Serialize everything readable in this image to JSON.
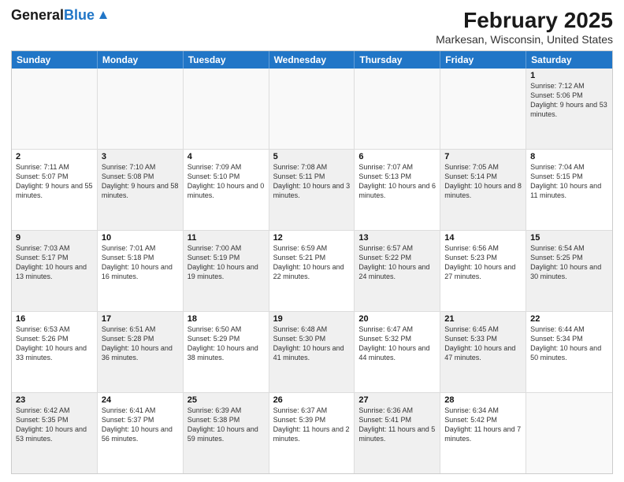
{
  "header": {
    "logo_general": "General",
    "logo_blue": "Blue",
    "title": "February 2025",
    "location": "Markesan, Wisconsin, United States"
  },
  "weekdays": [
    "Sunday",
    "Monday",
    "Tuesday",
    "Wednesday",
    "Thursday",
    "Friday",
    "Saturday"
  ],
  "weeks": [
    [
      {
        "day": "",
        "info": "",
        "empty": true
      },
      {
        "day": "",
        "info": "",
        "empty": true
      },
      {
        "day": "",
        "info": "",
        "empty": true
      },
      {
        "day": "",
        "info": "",
        "empty": true
      },
      {
        "day": "",
        "info": "",
        "empty": true
      },
      {
        "day": "",
        "info": "",
        "empty": true
      },
      {
        "day": "1",
        "info": "Sunrise: 7:12 AM\nSunset: 5:06 PM\nDaylight: 9 hours and 53 minutes.",
        "shaded": true
      }
    ],
    [
      {
        "day": "2",
        "info": "Sunrise: 7:11 AM\nSunset: 5:07 PM\nDaylight: 9 hours and 55 minutes."
      },
      {
        "day": "3",
        "info": "Sunrise: 7:10 AM\nSunset: 5:08 PM\nDaylight: 9 hours and 58 minutes.",
        "shaded": true
      },
      {
        "day": "4",
        "info": "Sunrise: 7:09 AM\nSunset: 5:10 PM\nDaylight: 10 hours and 0 minutes."
      },
      {
        "day": "5",
        "info": "Sunrise: 7:08 AM\nSunset: 5:11 PM\nDaylight: 10 hours and 3 minutes.",
        "shaded": true
      },
      {
        "day": "6",
        "info": "Sunrise: 7:07 AM\nSunset: 5:13 PM\nDaylight: 10 hours and 6 minutes."
      },
      {
        "day": "7",
        "info": "Sunrise: 7:05 AM\nSunset: 5:14 PM\nDaylight: 10 hours and 8 minutes.",
        "shaded": true
      },
      {
        "day": "8",
        "info": "Sunrise: 7:04 AM\nSunset: 5:15 PM\nDaylight: 10 hours and 11 minutes."
      }
    ],
    [
      {
        "day": "9",
        "info": "Sunrise: 7:03 AM\nSunset: 5:17 PM\nDaylight: 10 hours and 13 minutes.",
        "shaded": true
      },
      {
        "day": "10",
        "info": "Sunrise: 7:01 AM\nSunset: 5:18 PM\nDaylight: 10 hours and 16 minutes."
      },
      {
        "day": "11",
        "info": "Sunrise: 7:00 AM\nSunset: 5:19 PM\nDaylight: 10 hours and 19 minutes.",
        "shaded": true
      },
      {
        "day": "12",
        "info": "Sunrise: 6:59 AM\nSunset: 5:21 PM\nDaylight: 10 hours and 22 minutes."
      },
      {
        "day": "13",
        "info": "Sunrise: 6:57 AM\nSunset: 5:22 PM\nDaylight: 10 hours and 24 minutes.",
        "shaded": true
      },
      {
        "day": "14",
        "info": "Sunrise: 6:56 AM\nSunset: 5:23 PM\nDaylight: 10 hours and 27 minutes."
      },
      {
        "day": "15",
        "info": "Sunrise: 6:54 AM\nSunset: 5:25 PM\nDaylight: 10 hours and 30 minutes.",
        "shaded": true
      }
    ],
    [
      {
        "day": "16",
        "info": "Sunrise: 6:53 AM\nSunset: 5:26 PM\nDaylight: 10 hours and 33 minutes."
      },
      {
        "day": "17",
        "info": "Sunrise: 6:51 AM\nSunset: 5:28 PM\nDaylight: 10 hours and 36 minutes.",
        "shaded": true
      },
      {
        "day": "18",
        "info": "Sunrise: 6:50 AM\nSunset: 5:29 PM\nDaylight: 10 hours and 38 minutes."
      },
      {
        "day": "19",
        "info": "Sunrise: 6:48 AM\nSunset: 5:30 PM\nDaylight: 10 hours and 41 minutes.",
        "shaded": true
      },
      {
        "day": "20",
        "info": "Sunrise: 6:47 AM\nSunset: 5:32 PM\nDaylight: 10 hours and 44 minutes."
      },
      {
        "day": "21",
        "info": "Sunrise: 6:45 AM\nSunset: 5:33 PM\nDaylight: 10 hours and 47 minutes.",
        "shaded": true
      },
      {
        "day": "22",
        "info": "Sunrise: 6:44 AM\nSunset: 5:34 PM\nDaylight: 10 hours and 50 minutes."
      }
    ],
    [
      {
        "day": "23",
        "info": "Sunrise: 6:42 AM\nSunset: 5:35 PM\nDaylight: 10 hours and 53 minutes.",
        "shaded": true
      },
      {
        "day": "24",
        "info": "Sunrise: 6:41 AM\nSunset: 5:37 PM\nDaylight: 10 hours and 56 minutes."
      },
      {
        "day": "25",
        "info": "Sunrise: 6:39 AM\nSunset: 5:38 PM\nDaylight: 10 hours and 59 minutes.",
        "shaded": true
      },
      {
        "day": "26",
        "info": "Sunrise: 6:37 AM\nSunset: 5:39 PM\nDaylight: 11 hours and 2 minutes."
      },
      {
        "day": "27",
        "info": "Sunrise: 6:36 AM\nSunset: 5:41 PM\nDaylight: 11 hours and 5 minutes.",
        "shaded": true
      },
      {
        "day": "28",
        "info": "Sunrise: 6:34 AM\nSunset: 5:42 PM\nDaylight: 11 hours and 7 minutes."
      },
      {
        "day": "",
        "info": "",
        "empty": true
      }
    ]
  ]
}
